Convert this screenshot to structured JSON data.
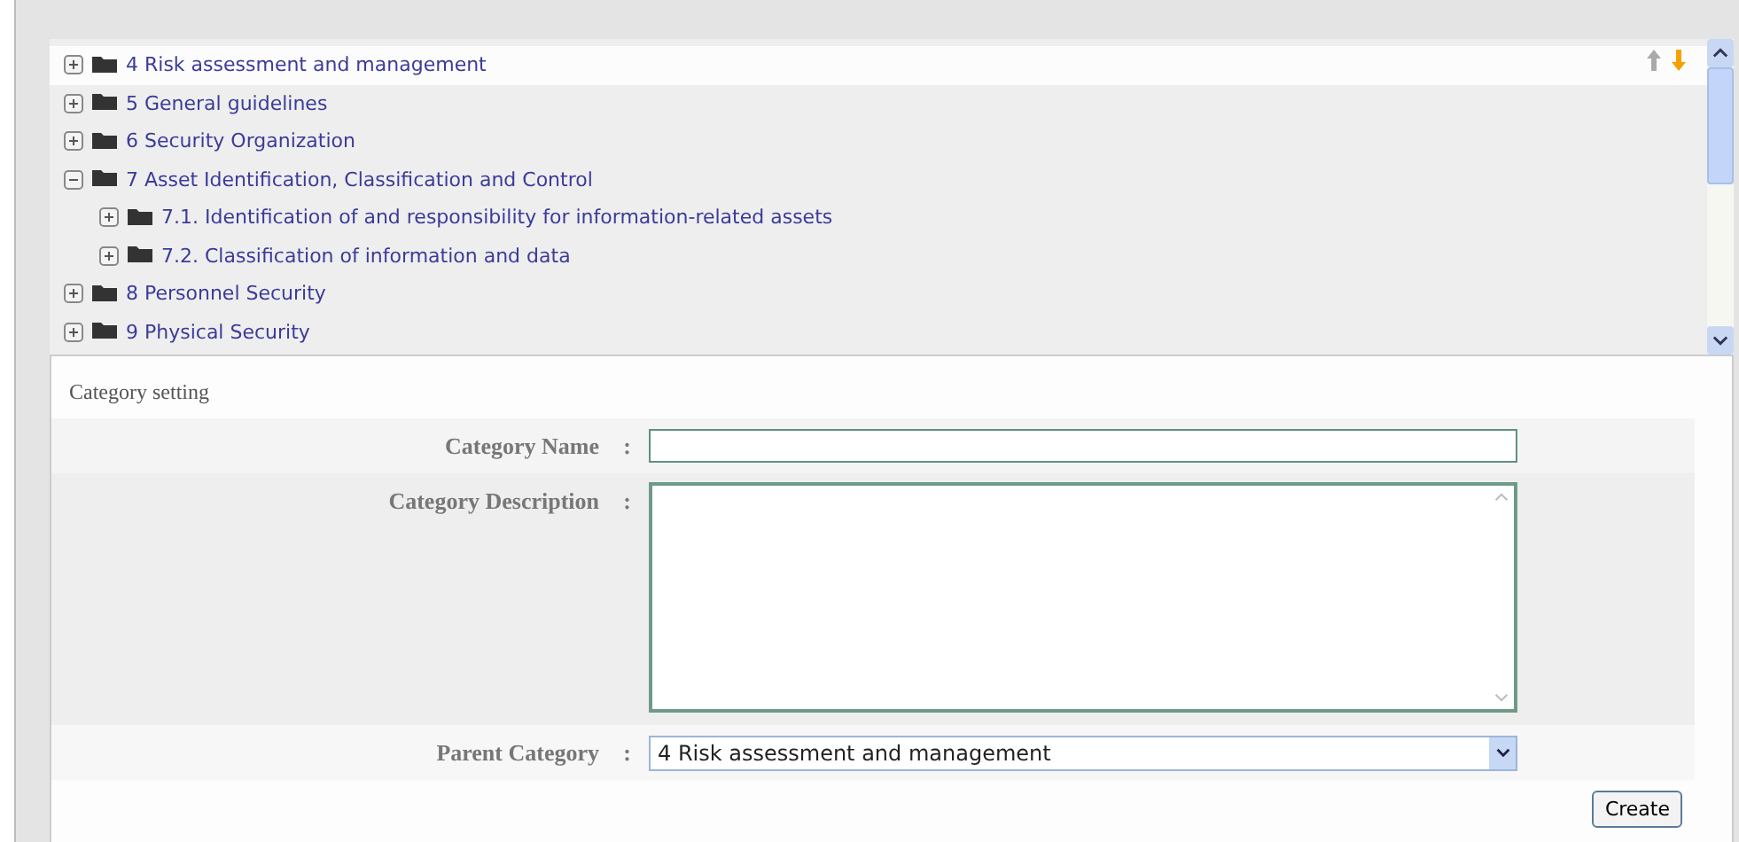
{
  "tree": [
    {
      "label": "4 Risk assessment and management",
      "expanded": false,
      "selected": true
    },
    {
      "label": "5 General guidelines",
      "expanded": false,
      "selected": false
    },
    {
      "label": "6 Security Organization",
      "expanded": false,
      "selected": false
    },
    {
      "label": "7 Asset Identification, Classification and Control",
      "expanded": true,
      "selected": false,
      "children": [
        {
          "label": "7.1. Identification of and responsibility for information-related assets",
          "expanded": false,
          "selected": false
        },
        {
          "label": "7.2. Classification of information and data",
          "expanded": false,
          "selected": false
        }
      ]
    },
    {
      "label": "8 Personnel Security",
      "expanded": false,
      "selected": false
    },
    {
      "label": "9 Physical Security",
      "expanded": false,
      "selected": false
    }
  ],
  "form": {
    "title": "Category setting",
    "fields": [
      {
        "kind": "text",
        "label": "Category Name",
        "sep": ":"
      },
      {
        "kind": "textarea",
        "label": "Category Description",
        "sep": ":"
      },
      {
        "kind": "select",
        "label": "Parent Category",
        "sep": ":",
        "value": "4 Risk assessment and management"
      }
    ],
    "button": "Create"
  }
}
